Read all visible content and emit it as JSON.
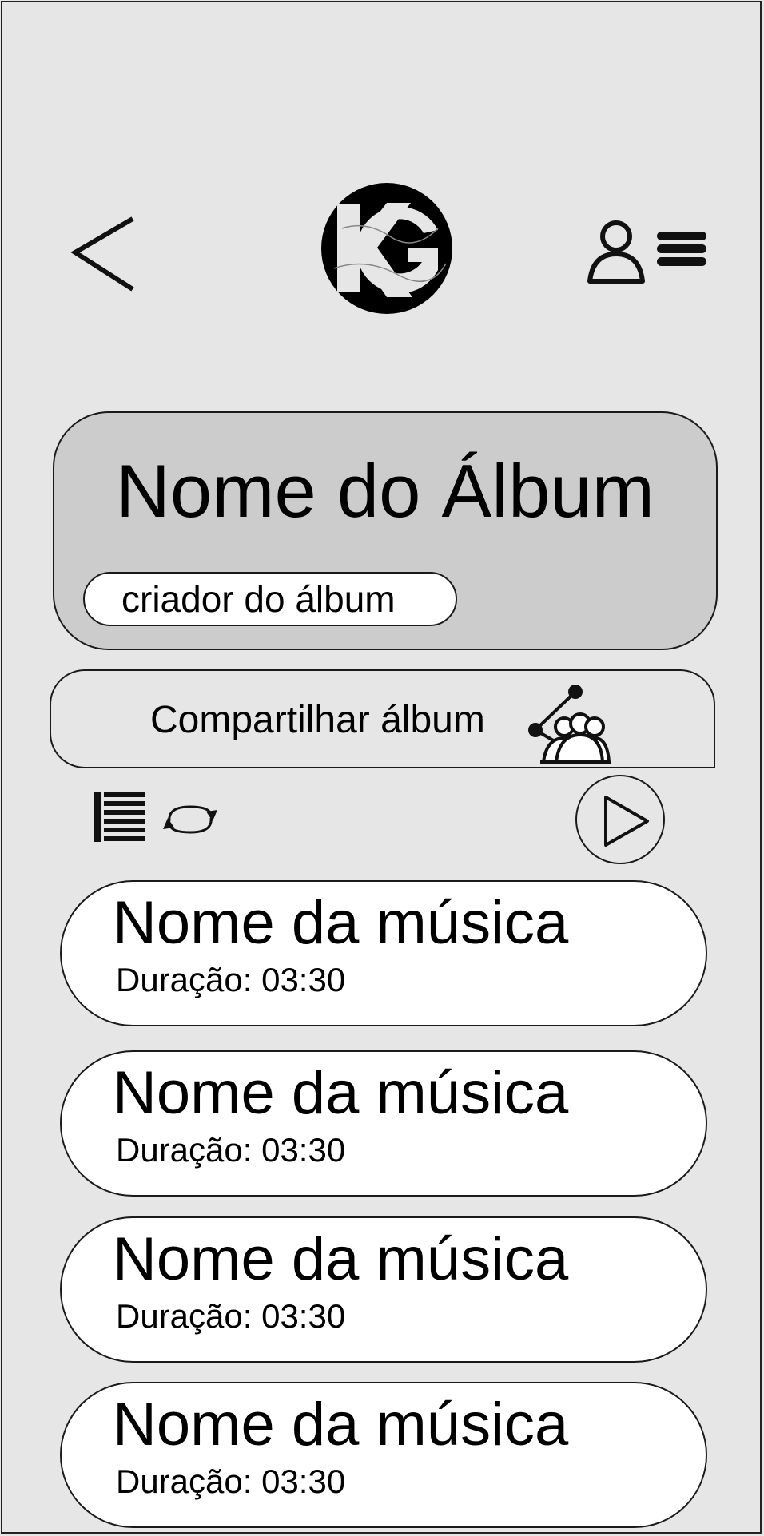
{
  "header": {
    "back_icon": "chevron-left-icon",
    "logo_text": "KG",
    "profile_icon": "user-icon",
    "menu_icon": "hamburger-menu-icon"
  },
  "album": {
    "title": "Nome do Álbum",
    "creator": "criador do álbum"
  },
  "share": {
    "label": "Compartilhar álbum",
    "icon": "share-group-icon"
  },
  "controls": {
    "queue_icon": "list-icon",
    "repeat_icon": "repeat-icon",
    "play_icon": "play-icon"
  },
  "songs": [
    {
      "name": "Nome da música",
      "duration": "Duração: 03:30"
    },
    {
      "name": "Nome da música",
      "duration": "Duração: 03:30"
    },
    {
      "name": "Nome da música",
      "duration": "Duração: 03:30"
    },
    {
      "name": "Nome da música",
      "duration": "Duração: 03:30"
    }
  ],
  "colors": {
    "background": "#e6e6e6",
    "card": "#cccccc",
    "pill": "#ffffff",
    "stroke": "#1a1a1a"
  }
}
